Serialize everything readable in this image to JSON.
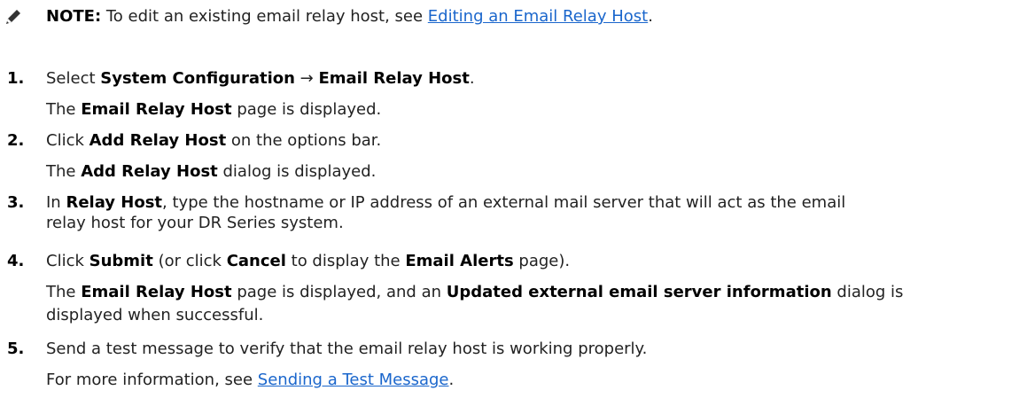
{
  "note": {
    "label": "NOTE:",
    "text": "To edit an existing email relay host, see",
    "link": "Editing an Email Relay Host",
    "end": "."
  },
  "steps": [
    {
      "number": "1.",
      "select": "Select",
      "menu_path_1": "System Configuration",
      "arrow": "→",
      "menu_path_2": "Email Relay Host",
      "end": ".",
      "result_pre": "The",
      "result_bold": "Email Relay Host",
      "result_post": "page is displayed."
    },
    {
      "number": "2.",
      "click": "Click",
      "button": "Add Relay Host",
      "rest": "on the options bar.",
      "result_pre": "The",
      "result_bold": "Add Relay Host",
      "result_post": "dialog is displayed."
    },
    {
      "number": "3.",
      "pre": "In",
      "field": "Relay Host",
      "line1": ", type the hostname or IP address of an external mail server that will act as the email",
      "line2": "relay host for your DR Series system."
    },
    {
      "number": "4.",
      "click": "Click",
      "submit": "Submit",
      "or_click": "(or click",
      "cancel": "Cancel",
      "to_display": "to display the",
      "alerts": "Email Alerts",
      "page_end": "page).",
      "result_pre": "The",
      "result_bold": "Email Relay Host",
      "result_mid": "page is displayed, and an",
      "result_bold2": "Updated external email server information",
      "result_post": "dialog is",
      "result_line2": "displayed when successful."
    },
    {
      "number": "5.",
      "text": "Send a test message to verify that the email relay host is working properly.",
      "more_pre": "For more information, see",
      "more_link": "Sending a Test Message",
      "more_end": "."
    }
  ]
}
